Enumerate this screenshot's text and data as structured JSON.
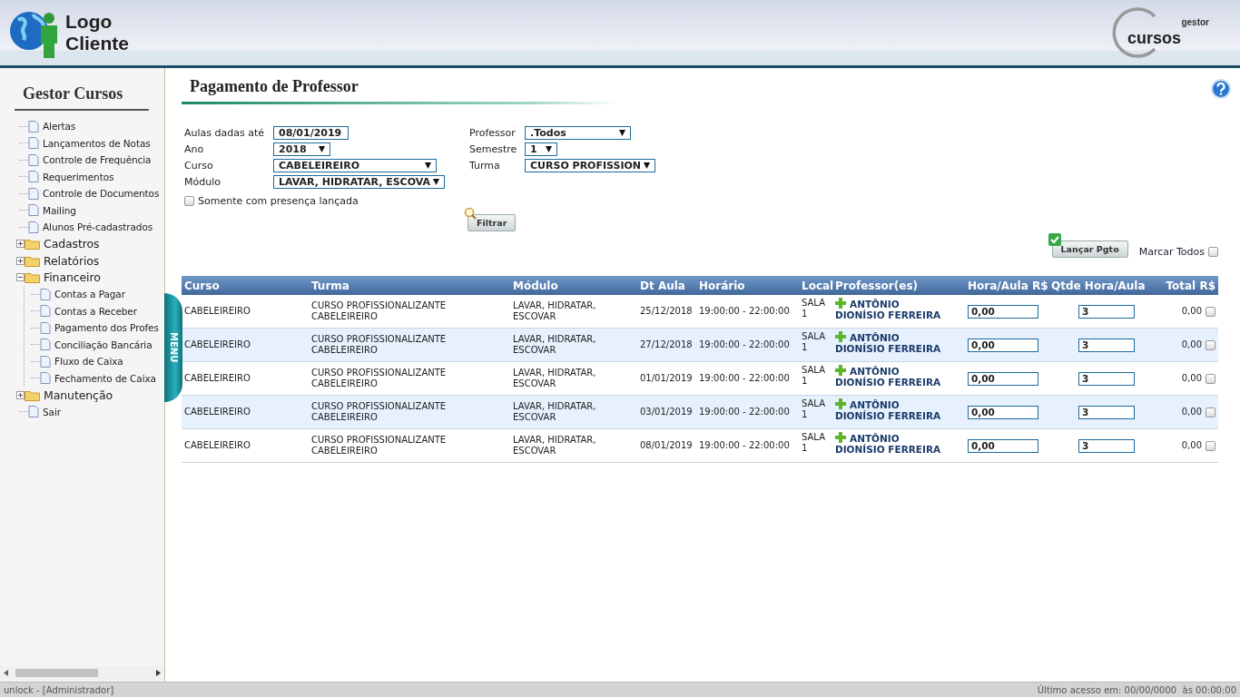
{
  "header": {
    "logo_lines": [
      "Logo",
      "Cliente"
    ],
    "brand": {
      "small": "gestor",
      "large": "cursos"
    }
  },
  "sidebar": {
    "title": "Gestor Cursos",
    "items": [
      {
        "kind": "page",
        "label": "Alertas"
      },
      {
        "kind": "page",
        "label": "Lançamentos de Notas"
      },
      {
        "kind": "page",
        "label": "Controle de Frequência"
      },
      {
        "kind": "page",
        "label": "Requerimentos"
      },
      {
        "kind": "page",
        "label": "Controle de Documentos"
      },
      {
        "kind": "page",
        "label": "Mailing"
      },
      {
        "kind": "page",
        "label": "Alunos Pré-cadastrados"
      },
      {
        "kind": "folder",
        "label": "Cadastros",
        "expanded": false
      },
      {
        "kind": "folder",
        "label": "Relatórios",
        "expanded": false
      },
      {
        "kind": "folder",
        "label": "Financeiro",
        "expanded": true,
        "children": [
          {
            "kind": "page",
            "label": "Contas a Pagar"
          },
          {
            "kind": "page",
            "label": "Contas a Receber"
          },
          {
            "kind": "page",
            "label": "Pagamento dos Profes"
          },
          {
            "kind": "page",
            "label": "Conciliação Bancária"
          },
          {
            "kind": "page",
            "label": "Fluxo de Caixa"
          },
          {
            "kind": "page",
            "label": "Fechamento de Caixa"
          }
        ]
      },
      {
        "kind": "folder",
        "label": "Manutenção",
        "expanded": false
      },
      {
        "kind": "page",
        "label": "Sair"
      }
    ]
  },
  "menu_tab": {
    "label": "MENU"
  },
  "page": {
    "title": "Pagamento de Professor"
  },
  "filters": {
    "left": [
      {
        "kind": "text",
        "label": "Aulas dadas até",
        "value": "08/01/2019"
      },
      {
        "kind": "select",
        "label": "Ano",
        "value": "2018"
      },
      {
        "kind": "select",
        "label": "Curso",
        "value": "CABELEIREIRO"
      },
      {
        "kind": "select",
        "label": "Módulo",
        "value": "LAVAR, HIDRATAR, ESCOVA"
      }
    ],
    "right": [
      {
        "kind": "select",
        "label": "Professor",
        "value": ".Todos"
      },
      {
        "kind": "select",
        "label": "Semestre",
        "value": "1"
      },
      {
        "kind": "select",
        "label": "Turma",
        "value": "CURSO PROFISSION"
      }
    ],
    "presence": {
      "label": "Somente com presença lançada",
      "checked": false
    },
    "filter_button": "Filtrar"
  },
  "actions": {
    "launch_button": "Lançar Pgto",
    "mark_all": {
      "label": "Marcar Todos",
      "checked": false
    }
  },
  "table": {
    "columns": [
      "Curso",
      "Turma",
      "Módulo",
      "Dt Aula",
      "Horário",
      "Local",
      "Professor(es)",
      "Hora/Aula R$",
      "Qtde Hora/Aula",
      "Total R$"
    ],
    "rows": [
      {
        "curso": "CABELEIREIRO",
        "turma": "CURSO PROFISSIONALIZANTE CABELEIREIRO",
        "modulo": "LAVAR, HIDRATAR, ESCOVAR",
        "dt_aula": "25/12/2018",
        "horario": "19:00:00 - 22:00:00",
        "local": "SALA 1",
        "professor": "ANTÔNIO DIONÍSIO FERREIRA",
        "hora_aula": "0,00",
        "qtde": "3",
        "total": "0,00",
        "checked": false
      },
      {
        "curso": "CABELEIREIRO",
        "turma": "CURSO PROFISSIONALIZANTE CABELEIREIRO",
        "modulo": "LAVAR, HIDRATAR, ESCOVAR",
        "dt_aula": "27/12/2018",
        "horario": "19:00:00 - 22:00:00",
        "local": "SALA 1",
        "professor": "ANTÔNIO DIONÍSIO FERREIRA",
        "hora_aula": "0,00",
        "qtde": "3",
        "total": "0,00",
        "checked": false
      },
      {
        "curso": "CABELEIREIRO",
        "turma": "CURSO PROFISSIONALIZANTE CABELEIREIRO",
        "modulo": "LAVAR, HIDRATAR, ESCOVAR",
        "dt_aula": "01/01/2019",
        "horario": "19:00:00 - 22:00:00",
        "local": "SALA 1",
        "professor": "ANTÔNIO DIONÍSIO FERREIRA",
        "hora_aula": "0,00",
        "qtde": "3",
        "total": "0,00",
        "checked": false
      },
      {
        "curso": "CABELEIREIRO",
        "turma": "CURSO PROFISSIONALIZANTE CABELEIREIRO",
        "modulo": "LAVAR, HIDRATAR, ESCOVAR",
        "dt_aula": "03/01/2019",
        "horario": "19:00:00 - 22:00:00",
        "local": "SALA 1",
        "professor": "ANTÔNIO DIONÍSIO FERREIRA",
        "hora_aula": "0,00",
        "qtde": "3",
        "total": "0,00",
        "checked": false
      },
      {
        "curso": "CABELEIREIRO",
        "turma": "CURSO PROFISSIONALIZANTE CABELEIREIRO",
        "modulo": "LAVAR, HIDRATAR, ESCOVAR",
        "dt_aula": "08/01/2019",
        "horario": "19:00:00 - 22:00:00",
        "local": "SALA 1",
        "professor": "ANTÔNIO DIONÍSIO FERREIRA",
        "hora_aula": "0,00",
        "qtde": "3",
        "total": "0,00",
        "checked": false
      }
    ]
  },
  "status_bar": {
    "user": "unlock - [Administrador]",
    "last_access": "Último acesso em: 00/00/0000  às 00:00:00"
  }
}
